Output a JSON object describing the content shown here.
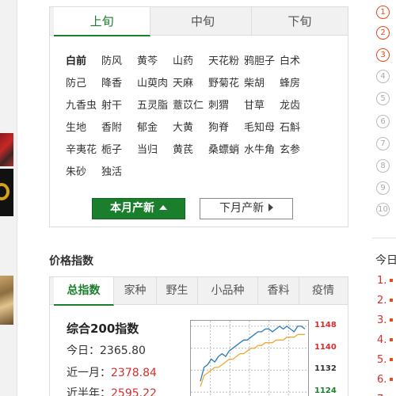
{
  "herb_tabs": [
    "上旬",
    "中旬",
    "下旬"
  ],
  "herbs": [
    "白前",
    "防风",
    "黄芩",
    "山药",
    "天花粉",
    "鸦胆子",
    "白术",
    "防己",
    "降香",
    "山萸肉",
    "天麻",
    "野菊花",
    "柴胡",
    "蜂房",
    "九香虫",
    "射干",
    "五灵脂",
    "薏苡仁",
    "刺猬",
    "甘草",
    "龙齿",
    "生地",
    "香附",
    "郁金",
    "大黄",
    "狗脊",
    "毛知母",
    "石斛",
    "辛夷花",
    "栀子",
    "当归",
    "黄芪",
    "桑螵蛸",
    "水牛角",
    "玄参",
    "朱砂",
    "独活"
  ],
  "month_buttons": {
    "current": "本月产新",
    "next": "下月产新"
  },
  "price_section_title": "价格指数",
  "price_tabs": [
    "总指数",
    "家种",
    "野生",
    "小品种",
    "香料",
    "疫情"
  ],
  "index": {
    "name": "综合200指数",
    "today_label": "今日：",
    "today_value": "2365.80",
    "month_label": "近一月：",
    "month_value": "2378.84",
    "halfyear_label": "近半年：",
    "halfyear_value": "2595.22"
  },
  "chart_data": {
    "type": "line",
    "ylim": [
      1120,
      1150
    ],
    "y_ticks": [
      "1148",
      "1140",
      "1132",
      "1124"
    ],
    "series": [
      {
        "values": [
          1128,
          1133,
          1134,
          1136,
          1135,
          1137,
          1138,
          1137,
          1139,
          1140,
          1141,
          1142,
          1143,
          1143,
          1144,
          1145,
          1146,
          1146,
          1147,
          1147,
          1146,
          1147,
          1148,
          1147,
          1148,
          1147,
          1146,
          1148,
          1148,
          1147
        ]
      },
      {
        "values": [
          1126,
          1130,
          1131,
          1132,
          1133,
          1133,
          1134,
          1135,
          1136,
          1136,
          1137,
          1138,
          1138,
          1139,
          1140,
          1140,
          1141,
          1141,
          1142,
          1142,
          1142,
          1143,
          1143,
          1143,
          1144,
          1144,
          1144,
          1145,
          1145,
          1145
        ]
      }
    ]
  },
  "rank_numbers": [
    "1",
    "2",
    "3",
    "4",
    "5",
    "6",
    "7",
    "8",
    "9",
    "10"
  ],
  "today_title": "今日",
  "today_items": [
    "1.",
    "2.",
    "3.",
    "4.",
    "5.",
    "6.",
    "7."
  ],
  "colors": {
    "green": "#1a7e2c",
    "red": "#d32f2f",
    "orange": "#e64a19"
  }
}
